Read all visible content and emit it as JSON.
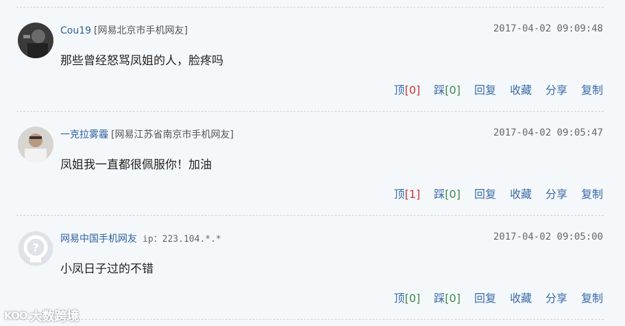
{
  "comments": [
    {
      "user": "Cou19",
      "location": "[网易北京市手机网友]",
      "ip": "",
      "time": "2017-04-02 09:09:48",
      "text": "那些曾经怒骂凤姐的人，脸疼吗",
      "actions": {
        "up_label": "顶",
        "up_count": "[0]",
        "down_label": "踩",
        "down_count": "[0]",
        "reply": "回复",
        "collect": "收藏",
        "share": "分享",
        "copy": "复制"
      },
      "avatar": "dark-photo"
    },
    {
      "user": "一克拉雾霾",
      "location": "[网易江苏省南京市手机网友]",
      "ip": "",
      "time": "2017-04-02 09:05:47",
      "text": "凤姐我一直都很佩服你！加油",
      "actions": {
        "up_label": "顶",
        "up_count": "[1]",
        "down_label": "踩",
        "down_count": "[0]",
        "reply": "回复",
        "collect": "收藏",
        "share": "分享",
        "copy": "复制"
      },
      "avatar": "light-photo"
    },
    {
      "user": "网易中国手机网友",
      "location": "",
      "ip": "ip：223.104.*.*",
      "time": "2017-04-02 09:05:00",
      "text": "小凤日子过的不错",
      "actions": {
        "up_label": "顶",
        "up_count": "[0]",
        "down_label": "踩",
        "down_count": "[0]",
        "reply": "回复",
        "collect": "收藏",
        "share": "分享",
        "copy": "复制"
      },
      "avatar": "default-avatar"
    }
  ],
  "watermark": {
    "logo": "KOO",
    "text": "大数跨境"
  },
  "colors": {
    "link": "#3a6aa8",
    "up": "#cc3333",
    "down": "#3a8a4a",
    "background": "#f5f8fb"
  }
}
